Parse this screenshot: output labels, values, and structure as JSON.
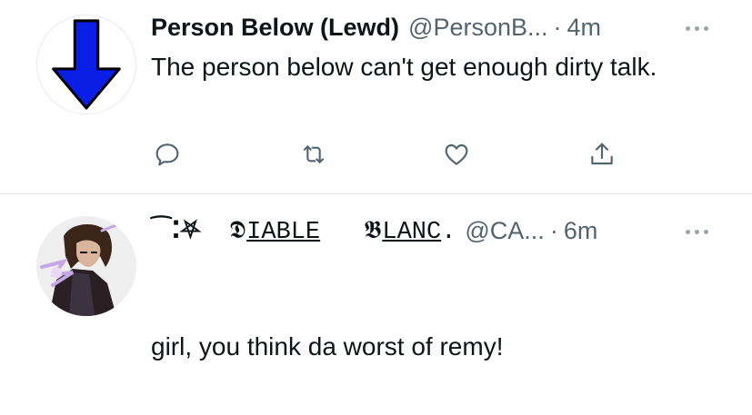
{
  "tweets": [
    {
      "display_name": "Person Below (Lewd)",
      "handle": "@PersonB...",
      "separator": "·",
      "time": "4m",
      "text": "The person below can't get enough dirty talk.",
      "avatar_icon": "blue-down-arrow-icon",
      "actions": [
        {
          "name": "reply",
          "icon": "reply-bubble-icon"
        },
        {
          "name": "retweet",
          "icon": "retweet-icon"
        },
        {
          "name": "like",
          "icon": "heart-icon"
        },
        {
          "name": "share",
          "icon": "share-icon"
        }
      ]
    },
    {
      "display_name_parts": {
        "glyphs": "⁀⁚⛧",
        "d1": "𝕯",
        "word1": "IABLE",
        "d2": "𝕭",
        "word2": "LANC",
        "end": "."
      },
      "handle": "@CA...",
      "separator": "·",
      "time": "6m",
      "text": "girl, you think da worst of remy!",
      "avatar_icon": "gambit-character-avatar"
    }
  ],
  "colors": {
    "text_primary": "#0f1419",
    "text_secondary": "#536471",
    "icon": "#536471",
    "divider": "#e6e9ea",
    "arrow_blue": "#0a1ee6"
  }
}
